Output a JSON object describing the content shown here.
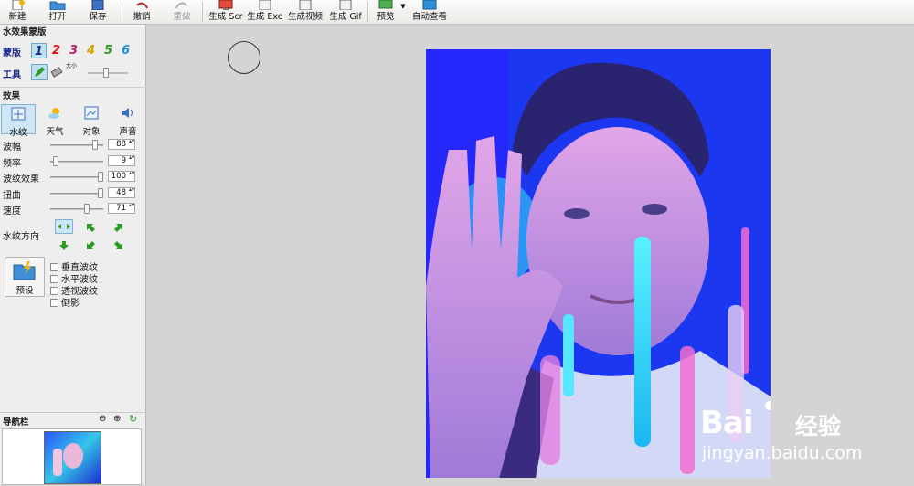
{
  "toolbar": {
    "new": "新建",
    "open": "打开",
    "save": "保存",
    "undo": "撤销",
    "redo": "重做",
    "gen_scr": "生成 Scr",
    "gen_exe": "生成 Exe",
    "gen_video": "生成视频",
    "gen_gif": "生成 Gif",
    "preview": "预览",
    "auto_view": "自动查看"
  },
  "mask_panel": {
    "title": "水效果蒙版",
    "mask_label": "蒙版",
    "numbers": [
      "1",
      "2",
      "3",
      "4",
      "5",
      "6"
    ],
    "tool_label": "工具",
    "size_label": "大小"
  },
  "effects": {
    "title": "效果",
    "tabs": [
      "水纹",
      "天气",
      "对象",
      "声音"
    ],
    "sliders": [
      {
        "name": "波幅",
        "value": "88",
        "pos": 0.88
      },
      {
        "name": "频率",
        "value": "9",
        "pos": 0.05
      },
      {
        "name": "波纹效果",
        "value": "100",
        "pos": 1.0
      },
      {
        "name": "扭曲",
        "value": "48",
        "pos": 1.0
      },
      {
        "name": "速度",
        "value": "71",
        "pos": 0.71
      }
    ],
    "direction_label": "水纹方向",
    "preset_label": "预设",
    "checkboxes": [
      "垂直波纹",
      "水平波纹",
      "透视波纹",
      "倒影"
    ]
  },
  "navigator": {
    "title": "导航栏"
  },
  "watermark": {
    "brand": "Bai",
    "cn": "经验",
    "url": "jingyan.baidu.com"
  },
  "colors": {
    "accent": "#1b2c8a",
    "photo_blue": "#1a3cf0"
  }
}
